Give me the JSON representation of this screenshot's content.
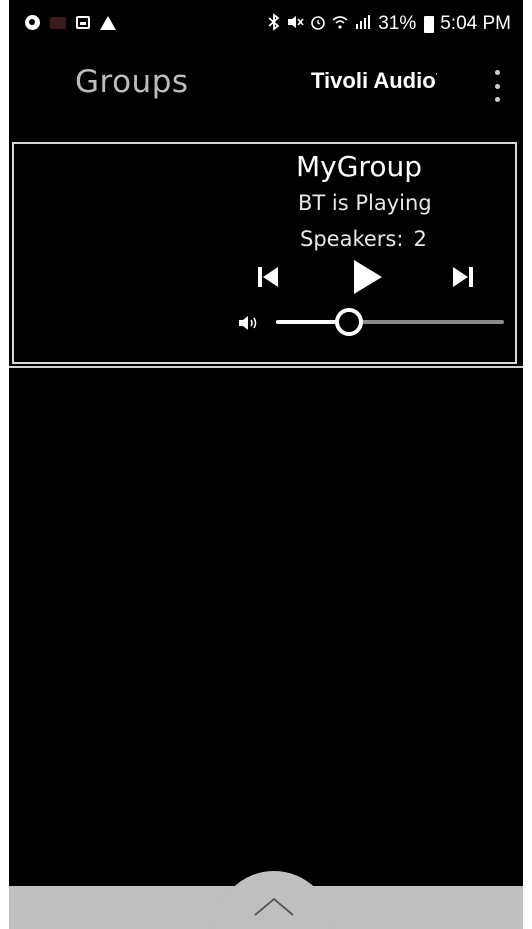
{
  "status_bar": {
    "battery": "31%",
    "time": "5:04 PM",
    "icons": [
      "app-icon",
      "notification-icon",
      "image-icon",
      "warning-icon",
      "bluetooth-icon",
      "mute-icon",
      "alarm-icon",
      "wifi-icon",
      "signal-icon",
      "battery-icon"
    ]
  },
  "app_bar": {
    "title": "Groups",
    "brand": "Tivoli Audio",
    "brand_mark": "'"
  },
  "group": {
    "name": "MyGroup",
    "status": "BT is Playing",
    "speakers_label": "Speakers:",
    "speakers_count": "2",
    "volume": 0.32
  },
  "colors": {
    "background": "#000000",
    "title_gray": "#bdbdbd",
    "card_border": "#d7d7d7",
    "bottom_bar": "#bfbfbf"
  }
}
